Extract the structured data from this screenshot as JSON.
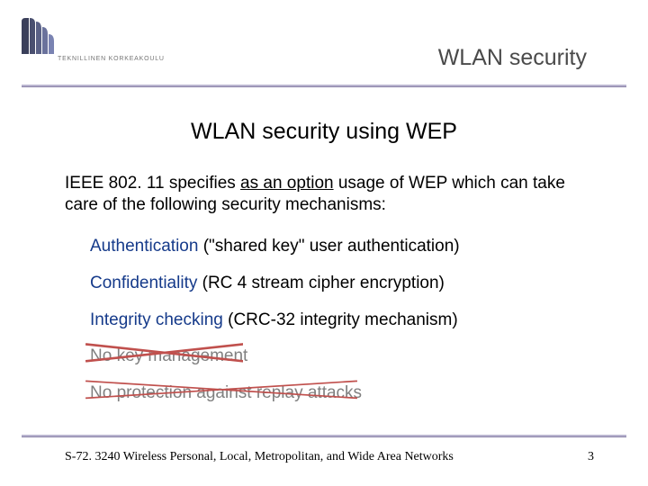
{
  "header": {
    "title": "WLAN security",
    "logo_text": "TEKNILLINEN KORKEAKOULU"
  },
  "section_title": "WLAN security using WEP",
  "intro": {
    "before": "IEEE 802. 11 specifies ",
    "underlined": "as an option",
    "after": " usage of WEP which can take care of the following security mechanisms:"
  },
  "bullets": [
    {
      "term": "Authentication",
      "rest": " (\"shared key\" user authentication)",
      "struck": false
    },
    {
      "term": "Confidentiality",
      "rest": " (RC 4 stream cipher encryption)",
      "struck": false
    },
    {
      "term": "Integrity checking",
      "rest": " (CRC-32 integrity mechanism)",
      "struck": false
    },
    {
      "term": "No key management",
      "rest": "",
      "struck": true
    },
    {
      "term": "No protection against replay attacks",
      "rest": "",
      "struck": true
    }
  ],
  "footer": {
    "text": "S-72. 3240 Wireless Personal, Local, Metropolitan, and Wide Area Networks",
    "page": "3"
  }
}
